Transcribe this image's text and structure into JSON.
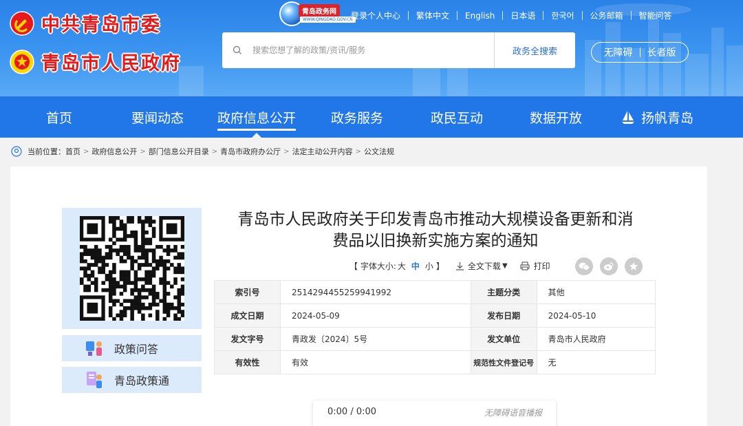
{
  "header": {
    "party_logo_text": "中共青岛市委",
    "gov_logo_text": "青岛市人民政府",
    "site_badge": {
      "name": "青岛政务网",
      "url": "WWW.QINGDAO.GOV.CN"
    },
    "top_links": [
      "登录个人中心",
      "繁体中文",
      "English",
      "日本语",
      "한국어",
      "公务邮箱",
      "智能问答"
    ],
    "search": {
      "placeholder": "搜索您想了解的政策/资讯/服务",
      "button": "政务全搜索"
    },
    "accessibility": {
      "barrier_free": "无障碍",
      "elder": "长者版"
    }
  },
  "nav": {
    "items": [
      "首页",
      "要闻动态",
      "政府信息公开",
      "政务服务",
      "政民互动",
      "数据开放",
      "扬帆青岛"
    ],
    "active": "政府信息公开"
  },
  "breadcrumb": {
    "prefix": "当前位置：",
    "items": [
      "首页",
      "政府信息公开",
      "部门信息公开目录",
      "青岛市政府办公厅",
      "法定主动公开内容",
      "公文法规"
    ]
  },
  "sidebar": {
    "policy_qa": "政策问答",
    "policy_pass": "青岛政策通"
  },
  "document": {
    "title_line1": "青岛市人民政府关于印发青岛市推动大规模设备更新和消",
    "title_line2": "费品以旧换新实施方案的通知",
    "font_size": {
      "label": "【 字体大小:",
      "large": "大",
      "medium": "中",
      "small": "小",
      "close": "】"
    },
    "download": "全文下载",
    "print": "打印",
    "meta": [
      {
        "k1": "索引号",
        "v1": "2514294455259941992",
        "k2": "主题分类",
        "v2": "其他"
      },
      {
        "k1": "成文日期",
        "v1": "2024-05-09",
        "k2": "发布日期",
        "v2": "2024-05-10"
      },
      {
        "k1": "发文字号",
        "v1": "青政发〔2024〕5号",
        "k2": "发文单位",
        "v2": "青岛市人民政府"
      },
      {
        "k1": "有效性",
        "v1": "有效",
        "k2": "规范性文件登记号",
        "v2": "无"
      }
    ]
  },
  "player": {
    "time": "0:00 / 0:00",
    "tag": "无障碍语音播报"
  },
  "colors": {
    "primary": "#2176e8",
    "logo_red": "#e61a1a",
    "card_bg": "#ffffff",
    "side_bg": "#dcebfc"
  }
}
